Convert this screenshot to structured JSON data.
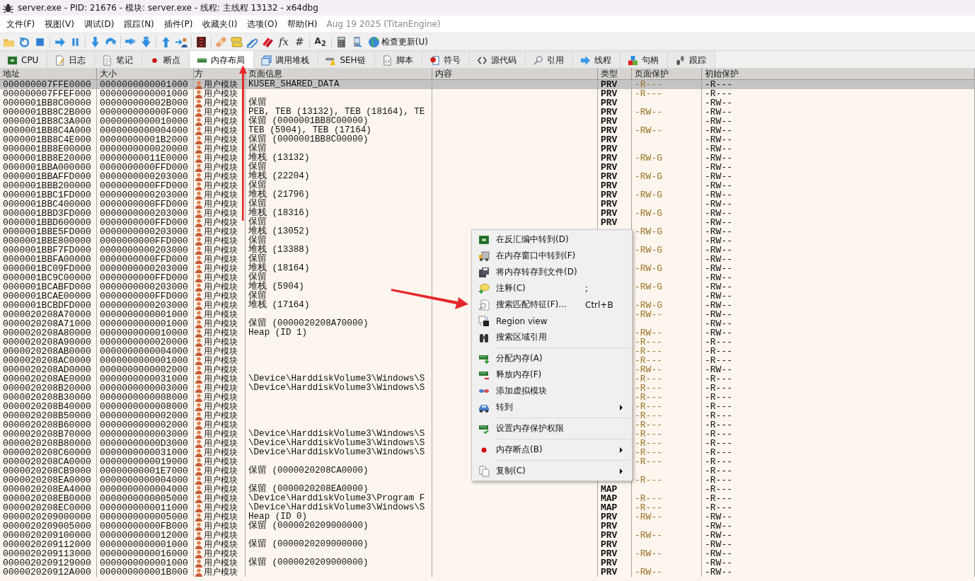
{
  "window": {
    "title": "server.exe - PID: 21676 - 模块: server.exe - 线程: 主线程 13132 - x64dbg"
  },
  "menu_bar": {
    "items": [
      "文件(F)",
      "视图(V)",
      "调试(D)",
      "跟踪(N)",
      "插件(P)",
      "收藏夹(I)",
      "选项(O)",
      "帮助(H)"
    ],
    "build_info": "Aug 19 2025 (TitanEngine)"
  },
  "toolbar": {
    "glyphs": [
      "fx",
      "#",
      "A$_{2}$"
    ],
    "update_button": "检查更新(U)"
  },
  "tabs": [
    {
      "label": "CPU",
      "selected": false
    },
    {
      "label": "日志",
      "selected": false
    },
    {
      "label": "笔记",
      "selected": false
    },
    {
      "label": "断点",
      "selected": false
    },
    {
      "label": "内存布局",
      "selected": true
    },
    {
      "label": "调用堆栈",
      "selected": false
    },
    {
      "label": "SEH链",
      "selected": false
    },
    {
      "label": "脚本",
      "selected": false
    },
    {
      "label": "符号",
      "selected": false
    },
    {
      "label": "源代码",
      "selected": false
    },
    {
      "label": "引用",
      "selected": false
    },
    {
      "label": "线程",
      "selected": false
    },
    {
      "label": "句柄",
      "selected": false
    },
    {
      "label": "跟踪",
      "selected": false
    }
  ],
  "table": {
    "columns": [
      "地址",
      "大小",
      "方",
      "页面信息",
      "内容",
      "类型",
      "页面保护",
      "初始保护"
    ],
    "rows": [
      {
        "address": "000000007FFE0000",
        "size": "0000000000001000",
        "owner": "用户模块",
        "info": "KUSER_SHARED_DATA",
        "type": "PRV",
        "protection": "-R---",
        "initial": "-R---",
        "selected": true
      },
      {
        "address": "000000007FFEF000",
        "size": "0000000000001000",
        "owner": "用户模块",
        "type": "PRV",
        "protection": "-R---",
        "initial": "-R---",
        "selected": false
      },
      {
        "address": "0000001BB8C00000",
        "size": "000000000002B000",
        "owner": "用户模块",
        "info": "保留",
        "type": "PRV",
        "initial": "-RW--",
        "selected": false
      },
      {
        "address": "0000001BB8C2B000",
        "size": "000000000000F000",
        "owner": "用户模块",
        "info": "PEB, TEB (13132), TEB (18164), TE",
        "type": "PRV",
        "protection": "-RW--",
        "initial": "-RW--",
        "selected": false
      },
      {
        "address": "0000001BB8C3A000",
        "size": "0000000000010000",
        "owner": "用户模块",
        "info": "保留 (0000001BB8C00000)",
        "type": "PRV",
        "initial": "-RW--",
        "selected": false
      },
      {
        "address": "0000001BB8C4A000",
        "size": "0000000000004000",
        "owner": "用户模块",
        "info": "TEB (5904), TEB (17164)",
        "type": "PRV",
        "protection": "-RW--",
        "initial": "-RW--",
        "selected": false
      },
      {
        "address": "0000001BB8C4E000",
        "size": "00000000001B2000",
        "owner": "用户模块",
        "info": "保留 (0000001BB8C00000)",
        "type": "PRV",
        "initial": "-RW--",
        "selected": false
      },
      {
        "address": "0000001BB8E00000",
        "size": "0000000000020000",
        "owner": "用户模块",
        "info": "保留",
        "type": "PRV",
        "initial": "-RW--",
        "selected": false
      },
      {
        "address": "0000001BB8E20000",
        "size": "00000000011E0000",
        "owner": "用户模块",
        "info": "堆栈 (13132)",
        "type": "PRV",
        "protection": "-RW-G",
        "initial": "-RW--",
        "selected": false
      },
      {
        "address": "0000001BBA000000",
        "size": "0000000000FFD000",
        "owner": "用户模块",
        "info": "保留",
        "type": "PRV",
        "initial": "-RW--",
        "selected": false
      },
      {
        "address": "0000001BBAFFD000",
        "size": "0000000000203000",
        "owner": "用户模块",
        "info": "堆栈 (22204)",
        "type": "PRV",
        "protection": "-RW-G",
        "initial": "-RW--",
        "selected": false
      },
      {
        "address": "0000001BBB200000",
        "size": "0000000000FFD000",
        "owner": "用户模块",
        "info": "保留",
        "type": "PRV",
        "initial": "-RW--",
        "selected": false
      },
      {
        "address": "0000001BBC1FD000",
        "size": "0000000000203000",
        "owner": "用户模块",
        "info": "堆栈 (21796)",
        "type": "PRV",
        "protection": "-RW-G",
        "initial": "-RW--",
        "selected": false
      },
      {
        "address": "0000001BBC400000",
        "size": "0000000000FFD000",
        "owner": "用户模块",
        "info": "保留",
        "type": "PRV",
        "initial": "-RW--",
        "selected": false
      },
      {
        "address": "0000001BBD3FD000",
        "size": "0000000000203000",
        "owner": "用户模块",
        "info": "堆栈 (18316)",
        "type": "PRV",
        "protection": "-RW-G",
        "initial": "-RW--",
        "selected": false
      },
      {
        "address": "0000001BBD600000",
        "size": "0000000000FFD000",
        "owner": "用户模块",
        "info": "保留",
        "type": "PRV",
        "initial": "-RW--",
        "selected": false
      },
      {
        "address": "0000001BBE5FD000",
        "size": "0000000000203000",
        "owner": "用户模块",
        "info": "堆栈 (13052)",
        "protection": "-RW-G",
        "initial": "-RW--",
        "selected": false
      },
      {
        "address": "0000001BBE800000",
        "size": "0000000000FFD000",
        "owner": "用户模块",
        "info": "保留",
        "initial": "-RW--",
        "selected": false
      },
      {
        "address": "0000001BBF7FD000",
        "size": "0000000000203000",
        "owner": "用户模块",
        "info": "堆栈 (13388)",
        "protection": "-RW-G",
        "initial": "-RW--",
        "selected": false
      },
      {
        "address": "0000001BBFA00000",
        "size": "0000000000FFD000",
        "owner": "用户模块",
        "info": "保留",
        "initial": "-RW--",
        "selected": false
      },
      {
        "address": "0000001BC09FD000",
        "size": "0000000000203000",
        "owner": "用户模块",
        "info": "堆栈 (18164)",
        "protection": "-RW-G",
        "initial": "-RW--",
        "selected": false
      },
      {
        "address": "0000001BC9C00000",
        "size": "0000000000FFD000",
        "owner": "用户模块",
        "info": "保留",
        "initial": "-RW--",
        "selected": false
      },
      {
        "address": "0000001BCABFD000",
        "size": "0000000000203000",
        "owner": "用户模块",
        "info": "堆栈 (5904)",
        "protection": "-RW-G",
        "initial": "-RW--",
        "selected": false
      },
      {
        "address": "0000001BCAE00000",
        "size": "0000000000FFD000",
        "owner": "用户模块",
        "info": "保留",
        "initial": "-RW--",
        "selected": false
      },
      {
        "address": "0000001BCBDFD000",
        "size": "0000000000203000",
        "owner": "用户模块",
        "info": "堆栈 (17164)",
        "protection": "-RW-G",
        "initial": "-RW--",
        "selected": false
      },
      {
        "address": "0000020208A70000",
        "size": "0000000000001000",
        "owner": "用户模块",
        "protection": "-RW--",
        "initial": "-RW--",
        "selected": false
      },
      {
        "address": "0000020208A71000",
        "size": "0000000000001000",
        "owner": "用户模块",
        "info": "保留 (0000020208A70000)",
        "initial": "-RW--",
        "selected": false
      },
      {
        "address": "0000020208A80000",
        "size": "0000000000010000",
        "owner": "用户模块",
        "info": "Heap (ID 1)",
        "protection": "-RW--",
        "initial": "-RW--",
        "selected": false
      },
      {
        "address": "0000020208A90000",
        "size": "0000000000020000",
        "owner": "用户模块",
        "protection": "-R---",
        "initial": "-R---",
        "selected": false
      },
      {
        "address": "0000020208AB0000",
        "size": "0000000000004000",
        "owner": "用户模块",
        "protection": "-R---",
        "initial": "-R---",
        "selected": false
      },
      {
        "address": "0000020208AC0000",
        "size": "0000000000001000",
        "owner": "用户模块",
        "protection": "-R---",
        "initial": "-R---",
        "selected": false
      },
      {
        "address": "0000020208AD0000",
        "size": "0000000000002000",
        "owner": "用户模块",
        "protection": "-RW--",
        "initial": "-RW--",
        "selected": false
      },
      {
        "address": "0000020208AE0000",
        "size": "0000000000031000",
        "owner": "用户模块",
        "info": "\\Device\\HarddiskVolume3\\Windows\\S",
        "protection": "-R---",
        "initial": "-R---",
        "selected": false
      },
      {
        "address": "0000020208B20000",
        "size": "0000000000003000",
        "owner": "用户模块",
        "info": "\\Device\\HarddiskVolume3\\Windows\\S",
        "protection": "-R---",
        "initial": "-R---",
        "selected": false
      },
      {
        "address": "0000020208B30000",
        "size": "0000000000008000",
        "owner": "用户模块",
        "protection": "-R---",
        "initial": "-R---",
        "selected": false
      },
      {
        "address": "0000020208B40000",
        "size": "0000000000008000",
        "owner": "用户模块",
        "protection": "-R---",
        "initial": "-R---",
        "selected": false
      },
      {
        "address": "0000020208B50000",
        "size": "0000000000002000",
        "owner": "用户模块",
        "protection": "-R---",
        "initial": "-R---",
        "selected": false
      },
      {
        "address": "0000020208B60000",
        "size": "0000000000002000",
        "owner": "用户模块",
        "protection": "-R---",
        "initial": "-R---",
        "selected": false
      },
      {
        "address": "0000020208B70000",
        "size": "0000000000003000",
        "owner": "用户模块",
        "info": "\\Device\\HarddiskVolume3\\Windows\\S",
        "protection": "-R---",
        "initial": "-R---",
        "selected": false
      },
      {
        "address": "0000020208B80000",
        "size": "00000000000D3000",
        "owner": "用户模块",
        "info": "\\Device\\HarddiskVolume3\\Windows\\S",
        "protection": "-R---",
        "initial": "-R---",
        "selected": false
      },
      {
        "address": "0000020208C60000",
        "size": "0000000000031000",
        "owner": "用户模块",
        "info": "\\Device\\HarddiskVolume3\\Windows\\S",
        "protection": "-R---",
        "initial": "-R---",
        "selected": false
      },
      {
        "address": "0000020208CA0000",
        "size": "0000000000019000",
        "owner": "用户模块",
        "protection": "-R---",
        "initial": "-R---",
        "selected": false
      },
      {
        "address": "0000020208CB9000",
        "size": "00000000001E7000",
        "owner": "用户模块",
        "info": "保留 (0000020208CA0000)",
        "initial": "-R---",
        "selected": false
      },
      {
        "address": "0000020208EA0000",
        "size": "0000000000004000",
        "owner": "用户模块",
        "protection": "-R---",
        "initial": "-R---",
        "selected": false
      },
      {
        "address": "0000020208EA4000",
        "size": "0000000000004000",
        "owner": "用户模块",
        "info": "保留 (0000020208EA0000)",
        "type": "MAP",
        "initial": "-R---",
        "selected": false
      },
      {
        "address": "0000020208EB0000",
        "size": "0000000000005000",
        "owner": "用户模块",
        "info": "\\Device\\HarddiskVolume3\\Program F",
        "type": "MAP",
        "protection": "-R---",
        "initial": "-R---",
        "selected": false
      },
      {
        "address": "0000020208EC0000",
        "size": "0000000000011000",
        "owner": "用户模块",
        "info": "\\Device\\HarddiskVolume3\\Windows\\S",
        "type": "MAP",
        "protection": "-R---",
        "initial": "-R---",
        "selected": false
      },
      {
        "address": "0000020209000000",
        "size": "0000000000005000",
        "owner": "用户模块",
        "info": "Heap (ID 0)",
        "type": "PRV",
        "protection": "-RW--",
        "initial": "-RW--",
        "selected": false
      },
      {
        "address": "0000020209005000",
        "size": "00000000000FB000",
        "owner": "用户模块",
        "info": "保留 (0000020209000000)",
        "type": "PRV",
        "initial": "-RW--",
        "selected": false
      },
      {
        "address": "0000020209100000",
        "size": "0000000000012000",
        "owner": "用户模块",
        "type": "PRV",
        "protection": "-RW--",
        "initial": "-RW--",
        "selected": false
      },
      {
        "address": "0000020209112000",
        "size": "0000000000001000",
        "owner": "用户模块",
        "info": "保留 (0000020209000000)",
        "type": "PRV",
        "initial": "-RW--",
        "selected": false
      },
      {
        "address": "0000020209113000",
        "size": "0000000000016000",
        "owner": "用户模块",
        "type": "PRV",
        "protection": "-RW--",
        "initial": "-RW--",
        "selected": false
      },
      {
        "address": "0000020209129000",
        "size": "0000000000001000",
        "owner": "用户模块",
        "info": "保留 (0000020209000000)",
        "type": "PRV",
        "initial": "-RW--",
        "selected": false
      },
      {
        "address": "000002020912A000",
        "size": "000000000001B000",
        "owner": "用户模块",
        "type": "PRV",
        "protection": "-RW--",
        "initial": "-RW--",
        "selected": false
      }
    ]
  },
  "context_menu": {
    "items": [
      {
        "kind": "item",
        "label": "在反汇编中转到(D)",
        "submenu": false
      },
      {
        "kind": "item",
        "label": "在内存窗口中转到(F)",
        "submenu": false
      },
      {
        "kind": "item",
        "label": "将内存转存到文件(D)",
        "submenu": false
      },
      {
        "kind": "item",
        "label": "注释(C)",
        "shortcut": ";",
        "submenu": false
      },
      {
        "kind": "item",
        "label": "搜索匹配特征(F)...",
        "shortcut": "Ctrl+B",
        "submenu": false
      },
      {
        "kind": "item",
        "label": "Region view",
        "submenu": false
      },
      {
        "kind": "item",
        "label": "搜索区域引用",
        "submenu": false
      },
      {
        "kind": "separator"
      },
      {
        "kind": "item",
        "label": "分配内存(A)",
        "submenu": false
      },
      {
        "kind": "item",
        "label": "释放内存(F)",
        "submenu": false
      },
      {
        "kind": "item",
        "label": "添加虚拟模块",
        "submenu": false
      },
      {
        "kind": "item",
        "label": "转到",
        "submenu": true
      },
      {
        "kind": "separator"
      },
      {
        "kind": "item",
        "label": "设置内存保护权限",
        "submenu": false
      },
      {
        "kind": "separator"
      },
      {
        "kind": "item",
        "label": "内存断点(B)",
        "submenu": true
      },
      {
        "kind": "separator"
      },
      {
        "kind": "item",
        "label": "复制(C)",
        "submenu": true
      }
    ]
  }
}
